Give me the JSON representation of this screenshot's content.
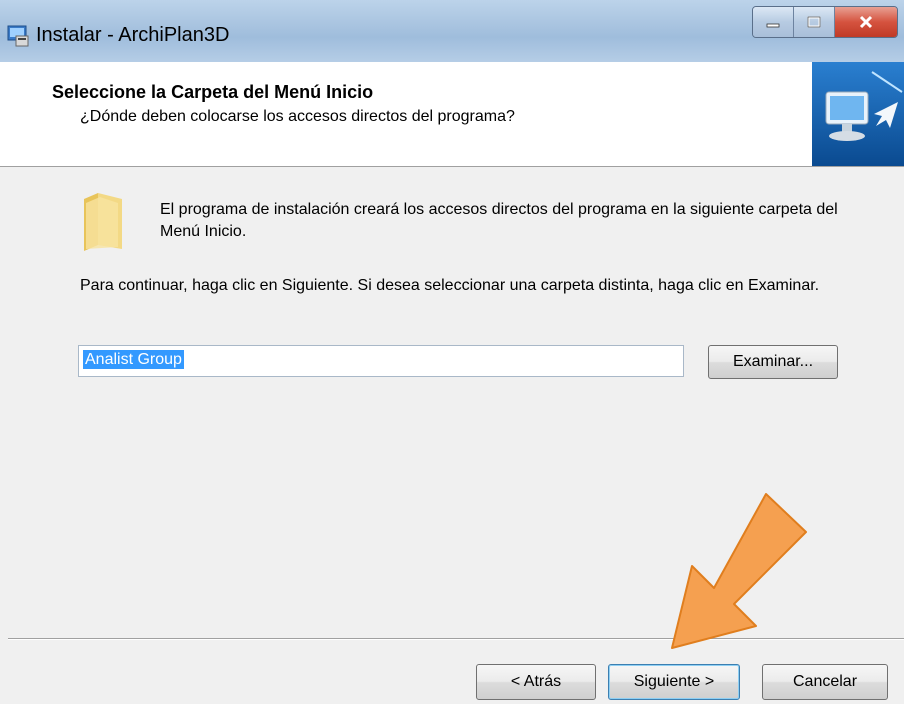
{
  "window": {
    "title": "Instalar - ArchiPlan3D",
    "minimize_icon": "minimize-icon",
    "maximize_icon": "maximize-icon",
    "close_icon": "close-icon"
  },
  "header": {
    "title": "Seleccione la Carpeta del Menú Inicio",
    "subtitle": "¿Dónde deben colocarse los accesos directos del programa?"
  },
  "content": {
    "info_text": "El programa de instalación creará los accesos directos del programa en la siguiente carpeta del Menú Inicio.",
    "instruction_text": "Para continuar, haga clic en Siguiente. Si desea seleccionar una carpeta distinta, haga clic en Examinar.",
    "folder_value": "Analist Group",
    "browse_label": "Examinar..."
  },
  "footer": {
    "back_label": "< Atrás",
    "next_label": "Siguiente >",
    "cancel_label": "Cancelar"
  },
  "colors": {
    "selection": "#3399ff",
    "annotation_arrow": "#f5a050"
  }
}
